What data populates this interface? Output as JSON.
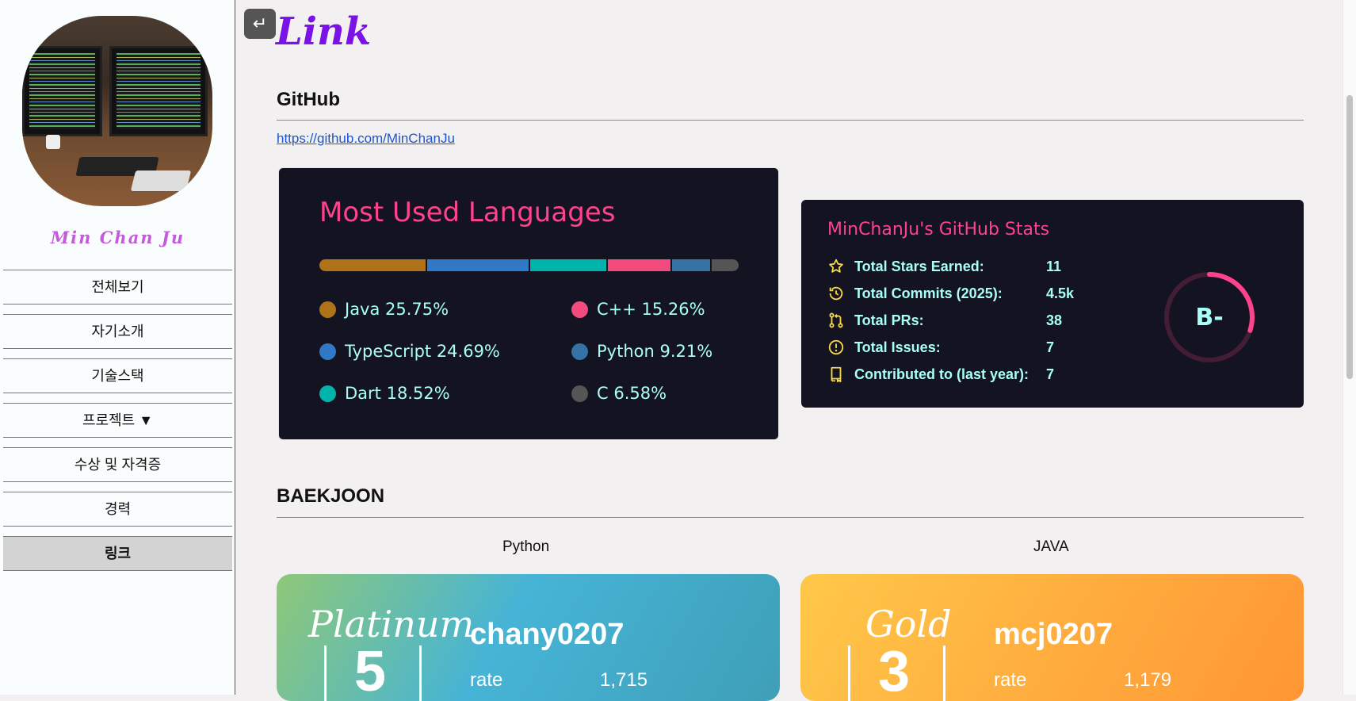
{
  "sidebar": {
    "name": "Min Chan Ju",
    "items": [
      {
        "label": "전체보기"
      },
      {
        "label": "자기소개"
      },
      {
        "label": "기술스택"
      },
      {
        "label": "프로젝트 ▼"
      },
      {
        "label": "수상 및 자격증"
      },
      {
        "label": "경력"
      },
      {
        "label": "링크"
      }
    ],
    "active_index": 6
  },
  "main": {
    "back_icon": "return-arrow-icon",
    "back_glyph": "↵",
    "title": "Link",
    "github": {
      "heading": "GitHub",
      "url": "https://github.com/MinChanJu",
      "languages_card": {
        "title": "Most Used Languages",
        "languages": [
          {
            "name": "Java",
            "percent": 25.75,
            "label": "Java 25.75%",
            "color": "#b07219"
          },
          {
            "name": "TypeScript",
            "percent": 24.69,
            "label": "TypeScript 24.69%",
            "color": "#3178c6"
          },
          {
            "name": "Dart",
            "percent": 18.52,
            "label": "Dart 18.52%",
            "color": "#00b4ab"
          },
          {
            "name": "C++",
            "percent": 15.26,
            "label": "C++ 15.26%",
            "color": "#f34b7d"
          },
          {
            "name": "Python",
            "percent": 9.21,
            "label": "Python 9.21%",
            "color": "#3572a5"
          },
          {
            "name": "C",
            "percent": 6.58,
            "label": "C 6.58%",
            "color": "#555555"
          }
        ]
      },
      "stats_card": {
        "title": "MinChanJu's GitHub Stats",
        "rows": [
          {
            "icon": "star-icon",
            "label": "Total Stars Earned:",
            "value": "11"
          },
          {
            "icon": "history-icon",
            "label": "Total Commits (2025):",
            "value": "4.5k"
          },
          {
            "icon": "pull-request-icon",
            "label": "Total PRs:",
            "value": "38"
          },
          {
            "icon": "issue-icon",
            "label": "Total Issues:",
            "value": "7"
          },
          {
            "icon": "repo-icon",
            "label": "Contributed to (last year):",
            "value": "7"
          }
        ],
        "rank": "B-",
        "rank_progress": 0.3
      }
    },
    "baekjoon": {
      "heading": "BAEKJOON",
      "cards": [
        {
          "language": "Python",
          "tier": "Platinum",
          "level": "5",
          "user": "chany0207",
          "rate_label": "rate",
          "rate": "1,715"
        },
        {
          "language": "JAVA",
          "tier": "Gold",
          "level": "3",
          "user": "mcj0207",
          "rate_label": "rate",
          "rate": "1,179"
        }
      ]
    }
  },
  "colors": {
    "title_purple": "#7a12e8",
    "name_pink": "#c45bdc",
    "card_bg": "#141321",
    "card_title": "#fe428e",
    "card_text": "#a9fef7",
    "icon_yellow": "#f8d847"
  }
}
